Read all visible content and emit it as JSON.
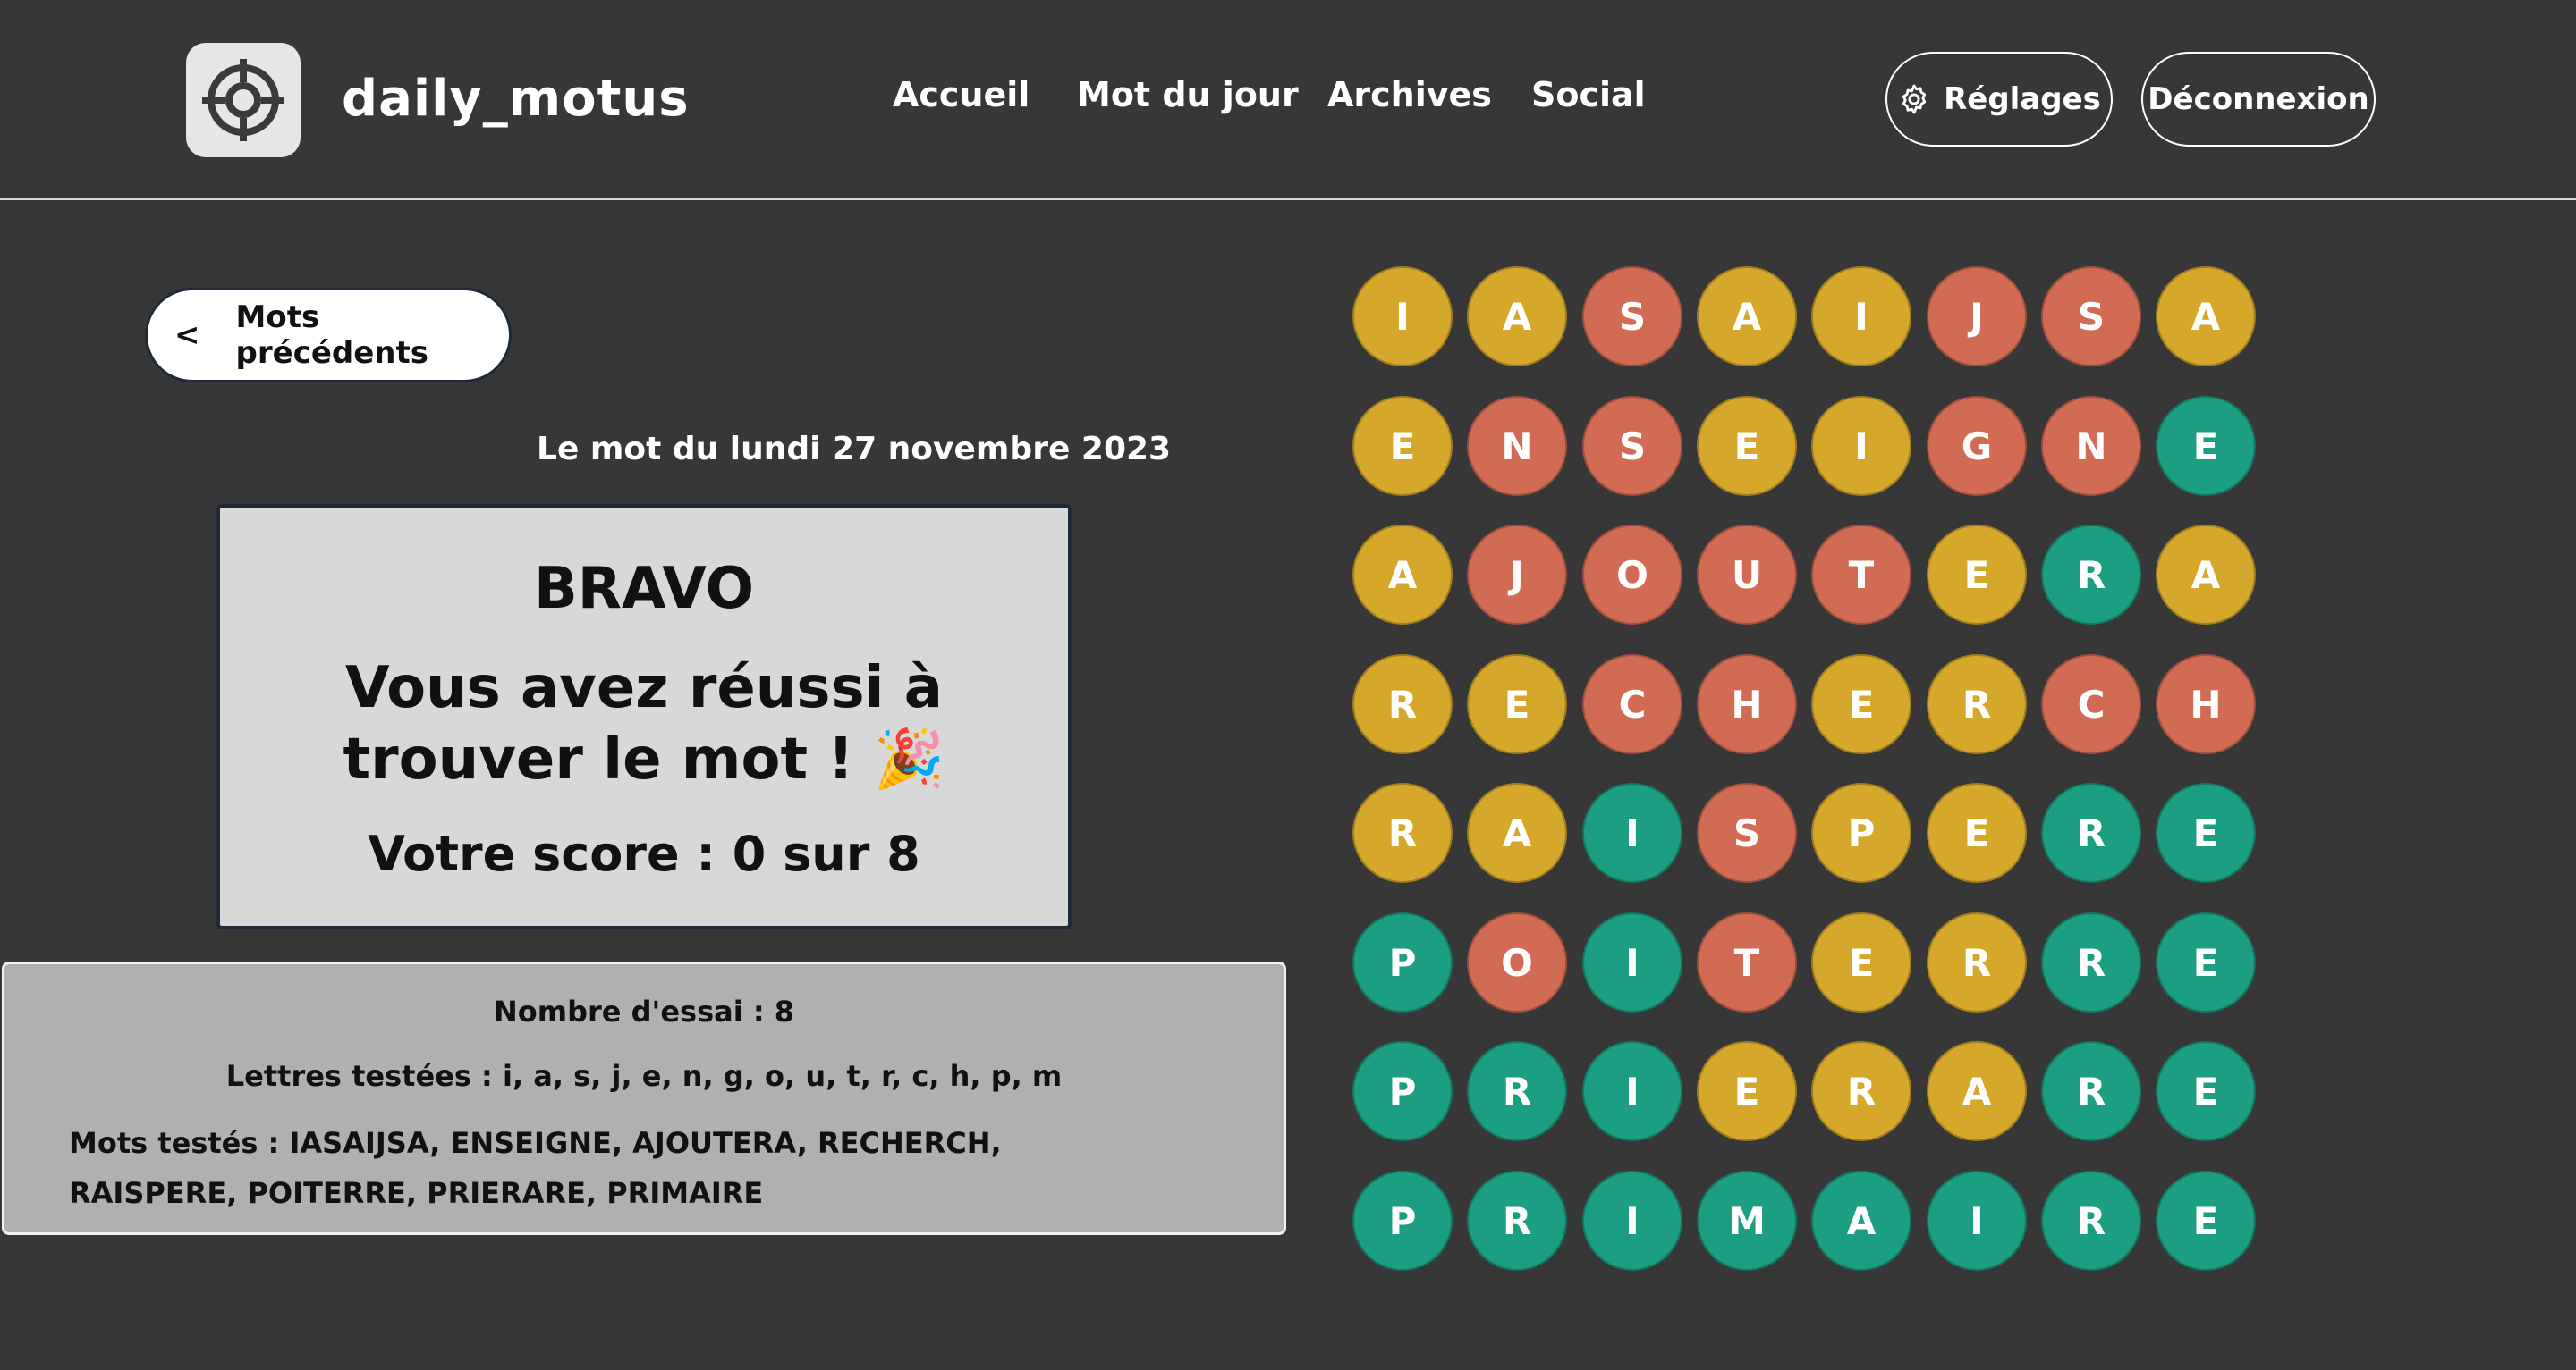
{
  "header": {
    "brand": "daily_motus",
    "nav": [
      "Accueil",
      "Mot du jour",
      "Archives",
      "Social"
    ],
    "settings_label": "Réglages",
    "logout_label": "Déconnexion"
  },
  "back_button": {
    "arrow": "<",
    "label": "Mots précédents"
  },
  "date_line": "Le mot du lundi 27 novembre 2023",
  "result": {
    "title": "BRAVO",
    "message": "Vous avez réussi à trouver le mot ! 🎉",
    "score": "Votre score : 0 sur 8"
  },
  "stats": {
    "attempts": "Nombre d'essai : 8",
    "letters": "Lettres testées : i, a, s, j, e, n, g, o, u, t, r, c, h, p, m",
    "words": "Mots testés : IASAIJSA, ENSEIGNE, AJOUTERA, RECHERCH, RAISPERE, POITERRE, PRIERARE, PRIMAIRE"
  },
  "colors": {
    "background": "#373737",
    "yellow": "#d5a82b",
    "red": "#d16b53",
    "green": "#1b9e82"
  },
  "grid": {
    "rows": [
      {
        "letters": [
          "I",
          "A",
          "S",
          "A",
          "I",
          "J",
          "S",
          "A"
        ],
        "states": [
          "y",
          "y",
          "r",
          "y",
          "y",
          "r",
          "r",
          "y"
        ]
      },
      {
        "letters": [
          "E",
          "N",
          "S",
          "E",
          "I",
          "G",
          "N",
          "E"
        ],
        "states": [
          "y",
          "r",
          "r",
          "y",
          "y",
          "r",
          "r",
          "g"
        ]
      },
      {
        "letters": [
          "A",
          "J",
          "O",
          "U",
          "T",
          "E",
          "R",
          "A"
        ],
        "states": [
          "y",
          "r",
          "r",
          "r",
          "r",
          "y",
          "g",
          "y"
        ]
      },
      {
        "letters": [
          "R",
          "E",
          "C",
          "H",
          "E",
          "R",
          "C",
          "H"
        ],
        "states": [
          "y",
          "y",
          "r",
          "r",
          "y",
          "y",
          "r",
          "r"
        ]
      },
      {
        "letters": [
          "R",
          "A",
          "I",
          "S",
          "P",
          "E",
          "R",
          "E"
        ],
        "states": [
          "y",
          "y",
          "g",
          "r",
          "y",
          "y",
          "g",
          "g"
        ]
      },
      {
        "letters": [
          "P",
          "O",
          "I",
          "T",
          "E",
          "R",
          "R",
          "E"
        ],
        "states": [
          "g",
          "r",
          "g",
          "r",
          "y",
          "y",
          "g",
          "g"
        ]
      },
      {
        "letters": [
          "P",
          "R",
          "I",
          "E",
          "R",
          "A",
          "R",
          "E"
        ],
        "states": [
          "g",
          "g",
          "g",
          "y",
          "y",
          "y",
          "g",
          "g"
        ]
      },
      {
        "letters": [
          "P",
          "R",
          "I",
          "M",
          "A",
          "I",
          "R",
          "E"
        ],
        "states": [
          "g",
          "g",
          "g",
          "g",
          "g",
          "g",
          "g",
          "g"
        ]
      }
    ]
  }
}
